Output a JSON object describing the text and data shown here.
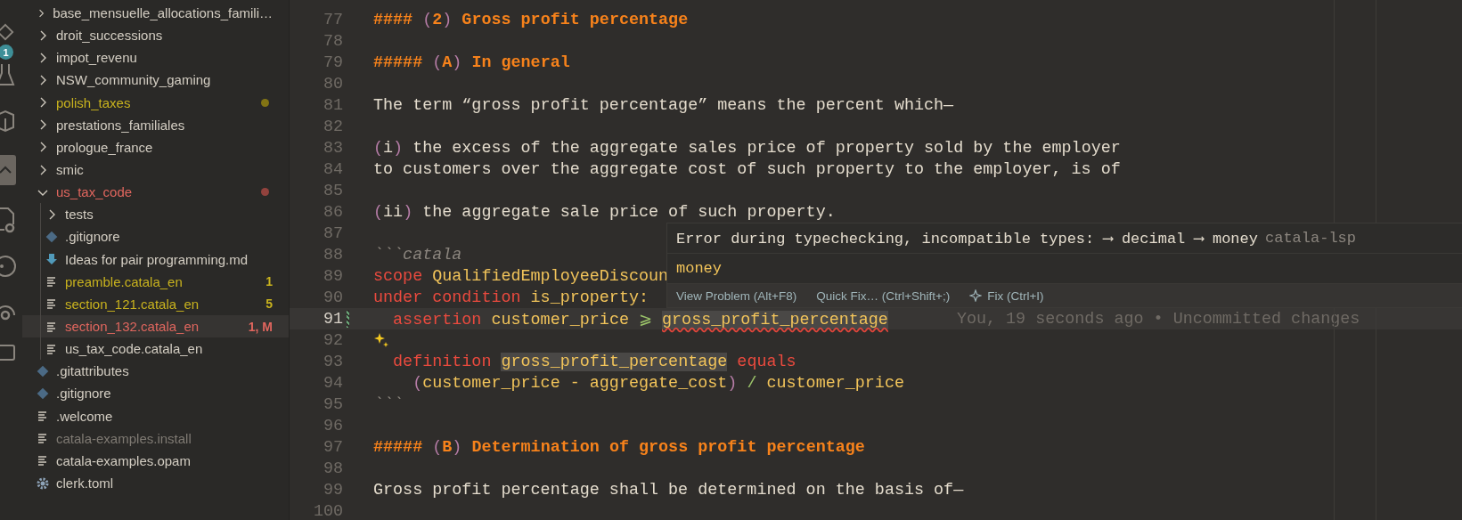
{
  "activity_bar": {
    "badge": "1"
  },
  "explorer": {
    "items": [
      {
        "name": "base_mensuelle_allocations_famili…",
        "kind": "folder",
        "expanded": false,
        "color": "#d3cdc2",
        "selected": false
      },
      {
        "name": "droit_successions",
        "kind": "folder",
        "expanded": false,
        "color": "#d3cdc2",
        "selected": false
      },
      {
        "name": "impot_revenu",
        "kind": "folder",
        "expanded": false,
        "color": "#d3cdc2",
        "selected": false
      },
      {
        "name": "NSW_community_gaming",
        "kind": "folder",
        "expanded": false,
        "color": "#d3cdc2",
        "selected": false
      },
      {
        "name": "polish_taxes",
        "kind": "folder",
        "expanded": false,
        "color": "#c8b21e",
        "dot": true,
        "selected": false
      },
      {
        "name": "prestations_familiales",
        "kind": "folder",
        "expanded": false,
        "color": "#d3cdc2",
        "selected": false
      },
      {
        "name": "prologue_france",
        "kind": "folder",
        "expanded": false,
        "color": "#d3cdc2",
        "selected": false
      },
      {
        "name": "smic",
        "kind": "folder",
        "expanded": false,
        "color": "#d3cdc2",
        "selected": false
      },
      {
        "name": "us_tax_code",
        "kind": "folder",
        "expanded": true,
        "color": "#e0665e",
        "dot": true,
        "selected": false,
        "children": [
          {
            "name": "tests",
            "kind": "folder",
            "expanded": false,
            "color": "#d3cdc2",
            "selected": false
          },
          {
            "name": ".gitignore",
            "kind": "git",
            "color": "#d3cdc2",
            "selected": false
          },
          {
            "name": "Ideas for pair programming.md",
            "kind": "markdown",
            "color": "#d3cdc2",
            "selected": false
          },
          {
            "name": "preamble.catala_en",
            "kind": "text",
            "color": "#c8b21e",
            "badge": "1",
            "selected": false
          },
          {
            "name": "section_121.catala_en",
            "kind": "text",
            "color": "#c8b21e",
            "badge": "5",
            "selected": false
          },
          {
            "name": "section_132.catala_en",
            "kind": "text",
            "color": "#e0665e",
            "badge": "1, M",
            "selected": true
          },
          {
            "name": "us_tax_code.catala_en",
            "kind": "text",
            "color": "#d3cdc2",
            "selected": false
          }
        ]
      },
      {
        "name": ".gitattributes",
        "kind": "git",
        "color": "#d3cdc2",
        "selected": false
      },
      {
        "name": ".gitignore",
        "kind": "git",
        "color": "#d3cdc2",
        "selected": false
      },
      {
        "name": ".welcome",
        "kind": "text",
        "color": "#d3cdc2",
        "selected": false
      },
      {
        "name": "catala-examples.install",
        "kind": "text",
        "color": "#7f7a73",
        "selected": false
      },
      {
        "name": "catala-examples.opam",
        "kind": "text",
        "color": "#d3cdc2",
        "selected": false
      },
      {
        "name": "clerk.toml",
        "kind": "gear",
        "color": "#d3cdc2",
        "selected": false
      }
    ]
  },
  "editor": {
    "lines": [
      {
        "number": "77",
        "tokens": [
          {
            "text": "#### ",
            "kind": "heading"
          },
          {
            "text": "(",
            "kind": "paren"
          },
          {
            "text": "2",
            "kind": "heading"
          },
          {
            "text": ")",
            "kind": "paren"
          },
          {
            "text": " Gross profit percentage",
            "kind": "heading"
          }
        ]
      },
      {
        "number": "78"
      },
      {
        "number": "79",
        "tokens": [
          {
            "text": "##### ",
            "kind": "heading"
          },
          {
            "text": "(",
            "kind": "paren"
          },
          {
            "text": "A",
            "kind": "heading"
          },
          {
            "text": ")",
            "kind": "paren"
          },
          {
            "text": " In general",
            "kind": "heading"
          }
        ]
      },
      {
        "number": "80"
      },
      {
        "number": "81",
        "tokens": [
          {
            "text": "The term “gross profit percentage” means the percent which—",
            "kind": "text"
          }
        ]
      },
      {
        "number": "82"
      },
      {
        "number": "83",
        "tokens": [
          {
            "text": "(",
            "kind": "paren"
          },
          {
            "text": "i",
            "kind": "text"
          },
          {
            "text": ")",
            "kind": "paren"
          },
          {
            "text": " the excess of the aggregate sales price of property sold by the employer",
            "kind": "text"
          }
        ]
      },
      {
        "number": "84",
        "tokens": [
          {
            "text": "to customers over the aggregate cost of such property to the employer, is of",
            "kind": "text"
          }
        ]
      },
      {
        "number": "85"
      },
      {
        "number": "86",
        "tokens": [
          {
            "text": "(",
            "kind": "paren"
          },
          {
            "text": "ii",
            "kind": "text"
          },
          {
            "text": ")",
            "kind": "paren"
          },
          {
            "text": " the aggregate sale price of such property.",
            "kind": "text"
          }
        ]
      },
      {
        "number": "87"
      },
      {
        "number": "88",
        "tokens": [
          {
            "text": "```catala",
            "kind": "comment"
          }
        ]
      },
      {
        "number": "89",
        "tokens": [
          {
            "text": "scope",
            "kind": "keyword"
          },
          {
            "text": " QualifiedEmployeeDiscoun",
            "kind": "ident"
          }
        ]
      },
      {
        "number": "90",
        "tokens": [
          {
            "text": "under condition",
            "kind": "keyword"
          },
          {
            "text": " is_property:",
            "kind": "ident"
          }
        ]
      },
      {
        "number": "91",
        "current": true,
        "changed": true,
        "blame": "You, 19 seconds ago • Uncommitted changes",
        "tokens": [
          {
            "text": "  assertion",
            "kind": "keyword"
          },
          {
            "text": " customer_price ",
            "kind": "ident"
          },
          {
            "text": "⩾ ",
            "kind": "op"
          },
          {
            "text": "gross_profit_percentage",
            "kind": "error"
          }
        ]
      },
      {
        "number": "92",
        "sparkle": true
      },
      {
        "number": "93",
        "tokens": [
          {
            "text": "  definition ",
            "kind": "keyword"
          },
          {
            "text": "gross_profit_percentage",
            "kind": "match"
          },
          {
            "text": " equals",
            "kind": "keyword"
          }
        ]
      },
      {
        "number": "94",
        "tokens": [
          {
            "text": "    (",
            "kind": "paren"
          },
          {
            "text": "customer_price - aggregate_cost",
            "kind": "ident"
          },
          {
            "text": ")",
            "kind": "paren"
          },
          {
            "text": " / ",
            "kind": "op"
          },
          {
            "text": "customer_price",
            "kind": "ident"
          }
        ]
      },
      {
        "number": "95",
        "tokens": [
          {
            "text": "```",
            "kind": "comment"
          }
        ]
      },
      {
        "number": "96"
      },
      {
        "number": "97",
        "tokens": [
          {
            "text": "##### ",
            "kind": "heading"
          },
          {
            "text": "(",
            "kind": "paren"
          },
          {
            "text": "B",
            "kind": "heading"
          },
          {
            "text": ")",
            "kind": "paren"
          },
          {
            "text": " Determination of gross profit percentage",
            "kind": "heading"
          }
        ]
      },
      {
        "number": "98"
      },
      {
        "number": "99",
        "tokens": [
          {
            "text": "Gross profit percentage shall be determined on the basis of—",
            "kind": "text"
          }
        ]
      },
      {
        "number": "100"
      }
    ],
    "hover": {
      "message": "Error during typechecking, incompatible types: ⟶ decimal ⟶ money",
      "source": "catala-lsp",
      "detail": "money",
      "actions": [
        {
          "label": "View Problem (Alt+F8)",
          "kind": "command"
        },
        {
          "label": "Quick Fix… (Ctrl+Shift+;)",
          "kind": "command"
        },
        {
          "label": "Fix (Ctrl+I)",
          "kind": "ai"
        }
      ]
    }
  }
}
